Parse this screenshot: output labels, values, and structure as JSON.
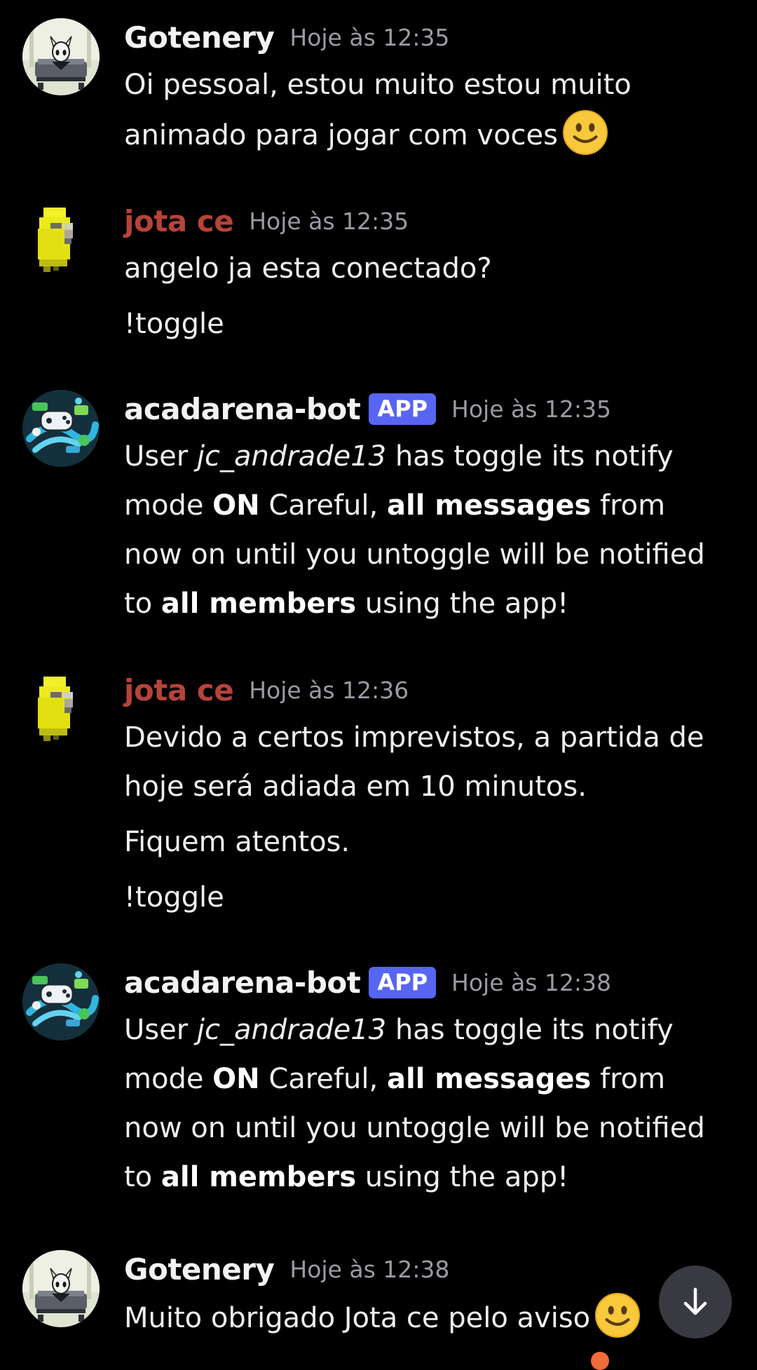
{
  "messages": [
    {
      "author": "Gotenery",
      "time": "Hoje às 12:35",
      "lines": [
        "Oi pessoal, estou muito estou muito",
        "animado para jogar com voces"
      ]
    },
    {
      "author": "jota ce",
      "time": "Hoje às 12:35",
      "lines": [
        "angelo ja esta conectado?",
        "!toggle"
      ]
    },
    {
      "author": "acadarena-bot",
      "badge": "APP",
      "time": "Hoje às 12:35",
      "parts": {
        "p1": "User ",
        "username": "jc_andrade13",
        "p2": " has toggle its notify mode ",
        "on": "ON",
        "p3": " Careful, ",
        "all_messages": "all messages",
        "p4": " from now on until you untoggle will be notified to ",
        "all_members": "all members",
        "p5": " using the app!"
      }
    },
    {
      "author": "jota ce",
      "time": "Hoje às 12:36",
      "lines": [
        "Devido a certos imprevistos, a partida de hoje será adiada em 10 minutos.",
        "Fiquem atentos.",
        "!toggle"
      ]
    },
    {
      "author": "acadarena-bot",
      "badge": "APP",
      "time": "Hoje às 12:38",
      "parts": {
        "p1": "User ",
        "username": "jc_andrade13",
        "p2": " has toggle its notify mode ",
        "on": "ON",
        "p3": " Careful, ",
        "all_messages": "all messages",
        "p4": " from now on until you untoggle will be notified to ",
        "all_members": "all members",
        "p5": " using the app!"
      }
    },
    {
      "author": "Gotenery",
      "time": "Hoje às 12:38",
      "lines": [
        "Muito obrigado Jota ce pelo aviso"
      ]
    }
  ],
  "icons": {
    "emoji": "slightly-smiling-face-icon",
    "scroll": "arrow-down-icon"
  },
  "colors": {
    "background": "#000000",
    "author_red": "#b6433a",
    "app_badge": "#5865f2",
    "timestamp": "#9a9ca4",
    "scroll_button": "#393a41"
  }
}
